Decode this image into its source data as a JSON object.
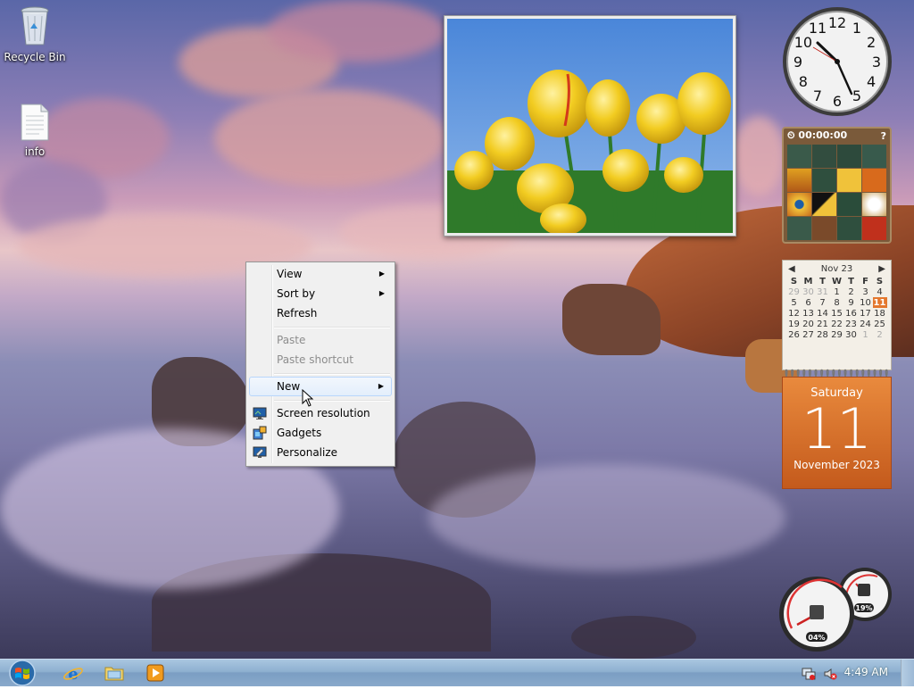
{
  "desktop_icons": [
    {
      "label": "Recycle Bin",
      "icon": "recycle-bin-icon"
    },
    {
      "label": "info",
      "icon": "text-document-icon"
    }
  ],
  "gadgets": {
    "clock": {
      "hour_numbers": [
        "12",
        "1",
        "2",
        "3",
        "4",
        "5",
        "6",
        "7",
        "8",
        "9",
        "10",
        "11"
      ]
    },
    "puzzle": {
      "timer": "00:00:00"
    },
    "calendar": {
      "month_label": "Nov 23",
      "weekdays": [
        "S",
        "M",
        "T",
        "W",
        "T",
        "F",
        "S"
      ],
      "weeks": [
        [
          "29",
          "30",
          "31",
          "1",
          "2",
          "3",
          "4"
        ],
        [
          "5",
          "6",
          "7",
          "8",
          "9",
          "10",
          "11"
        ],
        [
          "12",
          "13",
          "14",
          "15",
          "16",
          "17",
          "18"
        ],
        [
          "19",
          "20",
          "21",
          "22",
          "23",
          "24",
          "25"
        ],
        [
          "26",
          "27",
          "28",
          "29",
          "30",
          "1",
          "2"
        ]
      ],
      "day_name": "Saturday",
      "day_number": "11",
      "month_year": "November 2023"
    },
    "cpu_meter": {
      "cpu_percent": "04%",
      "memory_percent": "19%"
    }
  },
  "context_menu": {
    "items": [
      {
        "label": "View",
        "has_submenu": true,
        "enabled": true
      },
      {
        "label": "Sort by",
        "has_submenu": true,
        "enabled": true
      },
      {
        "label": "Refresh",
        "has_submenu": false,
        "enabled": true
      },
      {
        "label": "Paste",
        "has_submenu": false,
        "enabled": false
      },
      {
        "label": "Paste shortcut",
        "has_submenu": false,
        "enabled": false
      },
      {
        "label": "New",
        "has_submenu": true,
        "enabled": true,
        "highlighted": true
      },
      {
        "label": "Screen resolution",
        "has_submenu": false,
        "enabled": true,
        "icon": "screen-resolution-icon"
      },
      {
        "label": "Gadgets",
        "has_submenu": false,
        "enabled": true,
        "icon": "gadgets-icon"
      },
      {
        "label": "Personalize",
        "has_submenu": false,
        "enabled": true,
        "icon": "personalize-icon"
      }
    ]
  },
  "taskbar": {
    "pinned": [
      "internet-explorer-icon",
      "windows-explorer-icon",
      "media-player-icon"
    ],
    "tray_icons": [
      "network-icon",
      "volume-muted-icon"
    ],
    "time": "4:49 AM"
  },
  "colors": {
    "accent": "#e4772d",
    "taskbar": "#8eb0d0",
    "menu_bg": "#f0f0f0"
  }
}
